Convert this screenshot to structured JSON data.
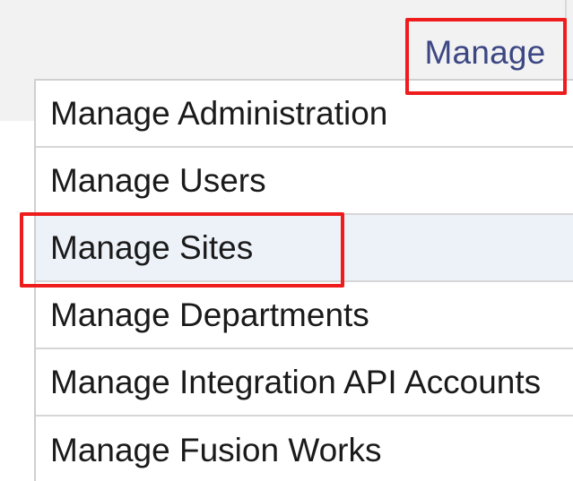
{
  "nav": {
    "manage_label": "Manage"
  },
  "dropdown": {
    "items": [
      {
        "label": "Manage Administration"
      },
      {
        "label": "Manage Users"
      },
      {
        "label": "Manage Sites"
      },
      {
        "label": "Manage Departments"
      },
      {
        "label": "Manage Integration API Accounts"
      },
      {
        "label": "Manage Fusion Works"
      }
    ]
  },
  "colors": {
    "nav_text": "#3c4784",
    "menu_text": "#1a1a1a",
    "hover_background": "#edf1f8",
    "callout": "#ee1c1c",
    "top_band": "#f2f2f2"
  }
}
